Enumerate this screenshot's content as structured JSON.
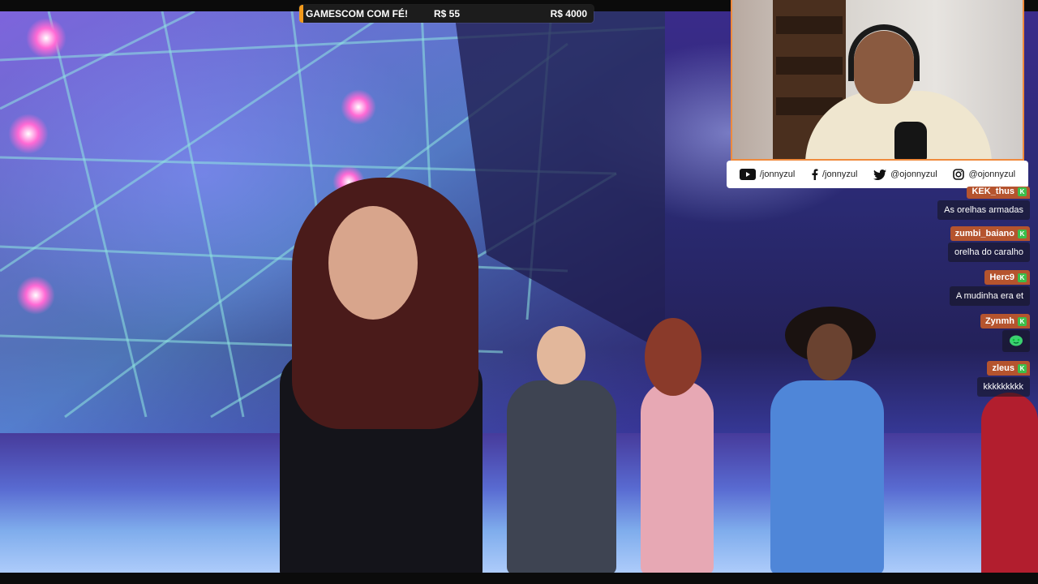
{
  "donation_bar": {
    "title": "GAMESCOM COM FÉ!",
    "current": "R$ 55",
    "goal": "R$ 4000",
    "accent_color": "#f29a1c"
  },
  "webcam": {
    "border_color": "#f08a3c"
  },
  "socials": [
    {
      "icon": "youtube-icon",
      "handle": "/jonnyzul"
    },
    {
      "icon": "facebook-icon",
      "handle": "/jonnyzul"
    },
    {
      "icon": "twitter-icon",
      "handle": "@ojonnyzul"
    },
    {
      "icon": "instagram-icon",
      "handle": "@ojonnyzul"
    }
  ],
  "chat": [
    {
      "user": "KEK_thus",
      "text": "As orelhas armadas"
    },
    {
      "user": "zumbi_baiano",
      "text": "orelha do caralho"
    },
    {
      "user": "Herc9",
      "text": "A mudinha era et"
    },
    {
      "user": "Zynmh",
      "text": "",
      "emote": "green-blob-emote"
    },
    {
      "user": "zleus",
      "text": "kkkkkkkkk"
    }
  ],
  "colors": {
    "username_bg": "#b5542e",
    "badge": "#3bbf4a"
  }
}
